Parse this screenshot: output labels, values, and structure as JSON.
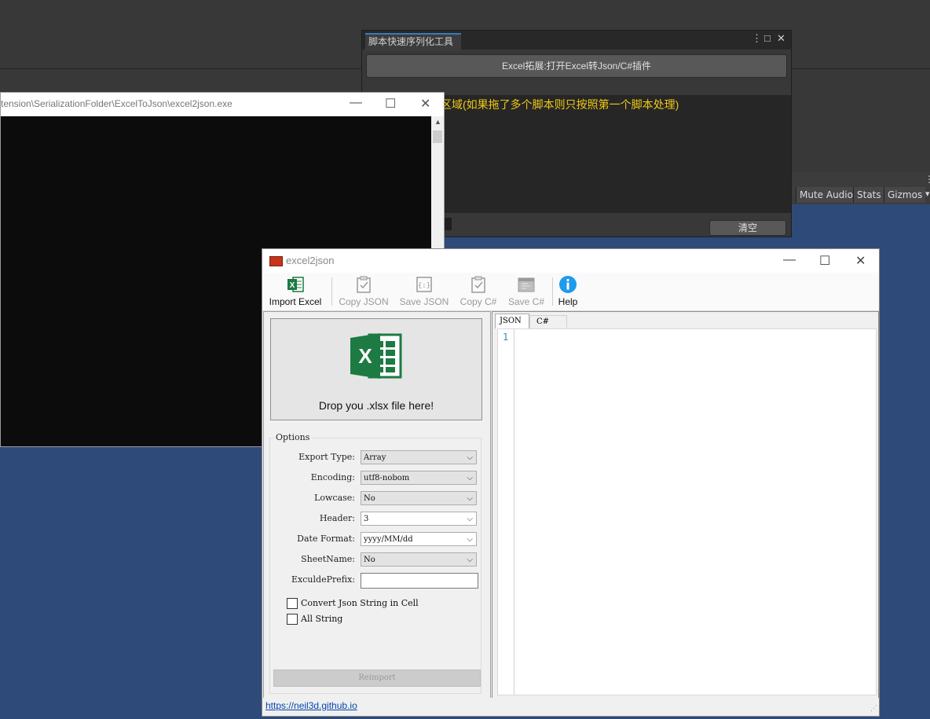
{
  "unity": {
    "right_buttons": [
      "Mute Audio",
      "Stats",
      "Gizmos"
    ],
    "gizmos_chevron": "▾"
  },
  "tool_window": {
    "tab": "脚本快速序列化工具",
    "menu_icon": "⋮",
    "maximize_icon": "□",
    "close_icon": "✕",
    "open_excel_button": "Excel拓展:打开Excel转Json/C#插件",
    "drop_hint": "区域(如果拖了多个脚本则只按照第一个脚本处理)",
    "clear_button": "清空"
  },
  "console": {
    "title": "tension\\SerializationFolder\\ExcelToJson\\excel2json.exe",
    "minimize": "—",
    "maximize": "☐",
    "close": "✕"
  },
  "excel2json": {
    "title": "excel2json",
    "minimize": "—",
    "maximize": "☐",
    "close": "✕",
    "toolbar": {
      "import_excel": "Import Excel",
      "copy_json": "Copy JSON",
      "save_json": "Save JSON",
      "copy_cs": "Copy C#",
      "save_cs": "Save C#",
      "help": "Help"
    },
    "drop_text": "Drop you .xlsx file here!",
    "options": {
      "legend": "Options",
      "export_type": {
        "label": "Export Type:",
        "value": "Array"
      },
      "encoding": {
        "label": "Encoding:",
        "value": "utf8-nobom"
      },
      "lowcase": {
        "label": "Lowcase:",
        "value": "No"
      },
      "header": {
        "label": "Header:",
        "value": "3"
      },
      "date_format": {
        "label": "Date Format:",
        "value": "yyyy/MM/dd"
      },
      "sheet_name": {
        "label": "SheetName:",
        "value": "No"
      },
      "exclude_prefix": {
        "label": "ExculdePrefix:",
        "value": ""
      },
      "convert_json": {
        "label": "Convert Json String in Cell",
        "checked": false
      },
      "all_string": {
        "label": "All String",
        "checked": false
      },
      "reimport": "Reimport"
    },
    "tabs": {
      "json": "JSON",
      "cs": "C#"
    },
    "editor": {
      "line1": "1"
    },
    "status_link": "https://neil3d.github.io",
    "chevron": "⌵",
    "grip": "⋰"
  },
  "colors": {
    "excel_green": "#1d7a43",
    "help_blue": "#1e9be9",
    "unity_highlight": "#f0c814"
  }
}
